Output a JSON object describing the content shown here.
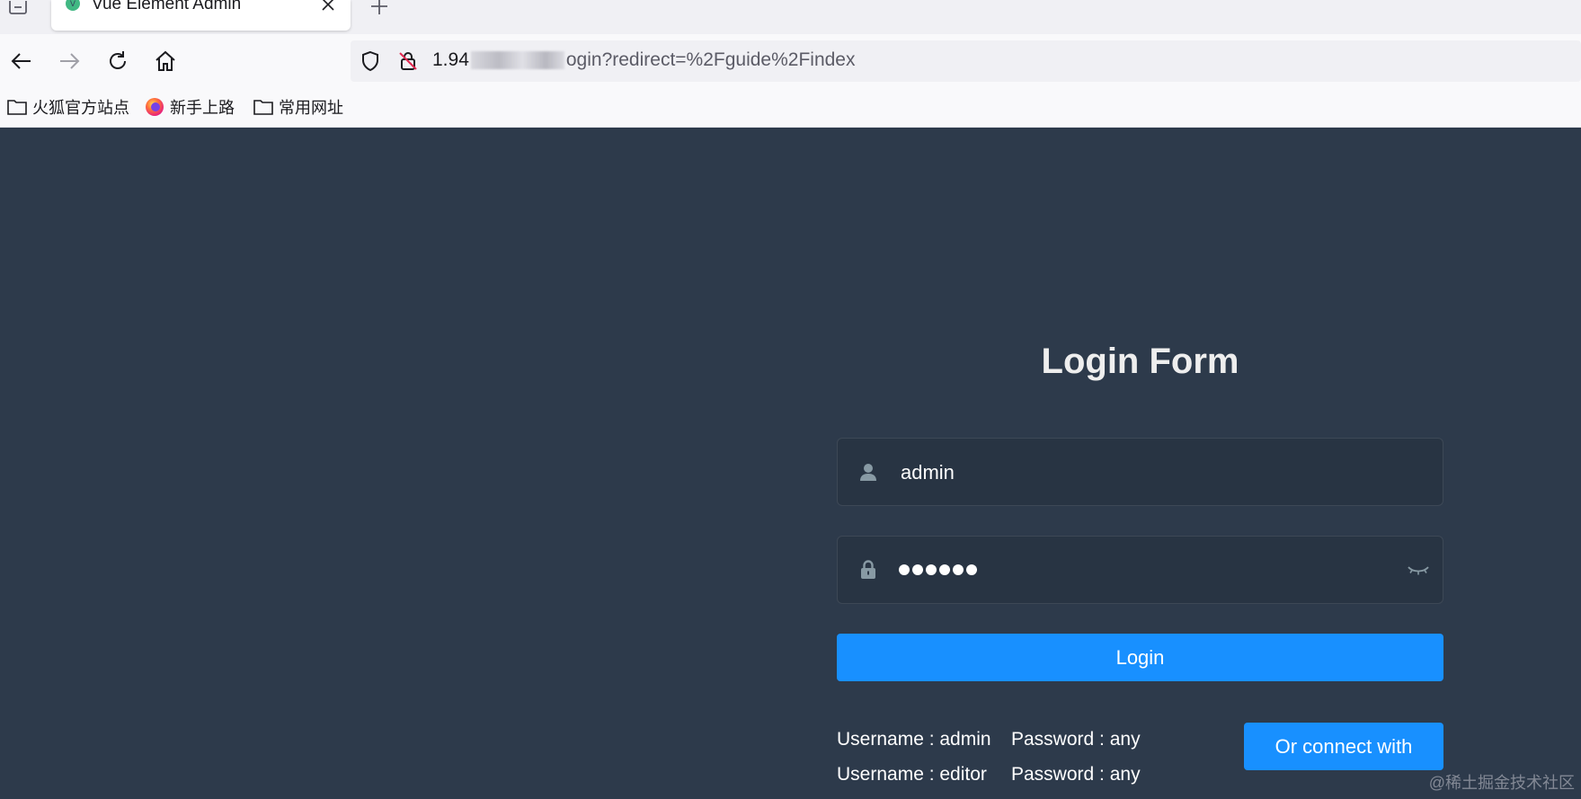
{
  "browser": {
    "tab": {
      "title": "Vue Element Admin"
    },
    "url": {
      "host_visible": "1.94",
      "path_visible": "ogin?redirect=%2Fguide%2Findex"
    },
    "bookmarks": [
      {
        "label": "火狐官方站点",
        "icon": "folder-icon"
      },
      {
        "label": "新手上路",
        "icon": "firefox-icon"
      },
      {
        "label": "常用网址",
        "icon": "folder-icon"
      }
    ]
  },
  "login": {
    "title": "Login Form",
    "username_value": "admin",
    "password_dots": 6,
    "login_button": "Login",
    "tips": [
      {
        "username": "Username : admin",
        "password": "Password : any"
      },
      {
        "username": "Username : editor",
        "password": "Password : any"
      }
    ],
    "connect_button": "Or connect with"
  },
  "watermark": "@稀土掘金技术社区",
  "colors": {
    "page_bg": "#2d3a4b",
    "field_bg": "#283443",
    "primary": "#1890ff",
    "title": "#eeeeee"
  }
}
